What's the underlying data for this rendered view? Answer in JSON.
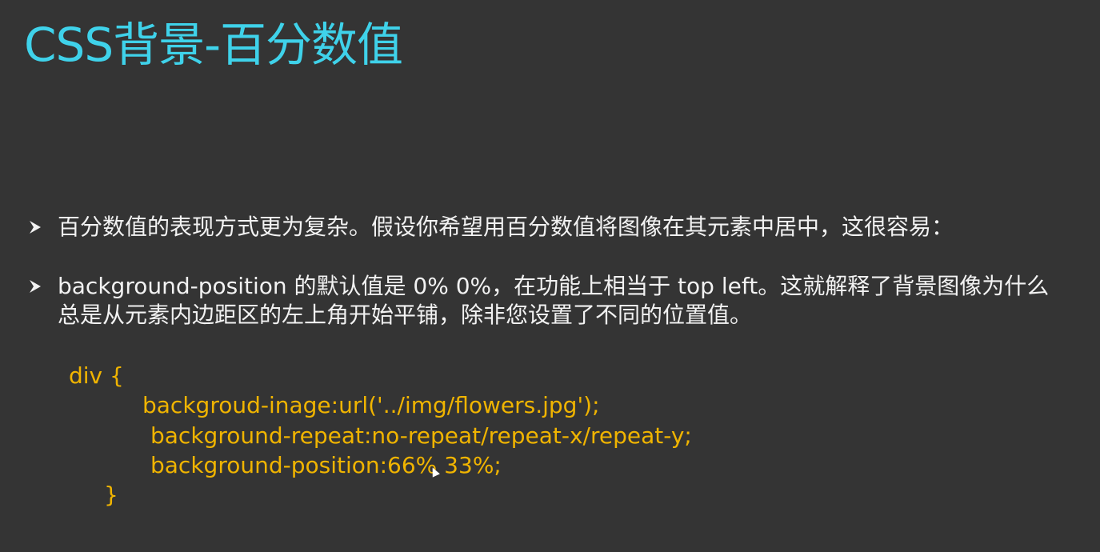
{
  "slide": {
    "title": "CSS背景-百分数值",
    "bullets": [
      {
        "icon": "arrow-bullet-icon",
        "text": "百分数值的表现方式更为复杂。假设你希望用百分数值将图像在其元素中居中，这很容易："
      },
      {
        "icon": "arrow-bullet-icon",
        "text": "background-position 的默认值是 0% 0%，在功能上相当于 top left。这就解释了背景图像为什么总是从元素内边距区的左上角开始平铺，除非您设置了不同的位置值。"
      }
    ],
    "code_lines": [
      "div {",
      "backgroud-inage:url('../img/flowers.jpg');",
      "background-repeat:no-repeat/repeat-x/repeat-y;",
      "background-position:66% 33%;",
      "}"
    ],
    "colors": {
      "background": "#343434",
      "title": "#3fd2ea",
      "body_text": "#f2f2f2",
      "code": "#f0b400"
    }
  }
}
